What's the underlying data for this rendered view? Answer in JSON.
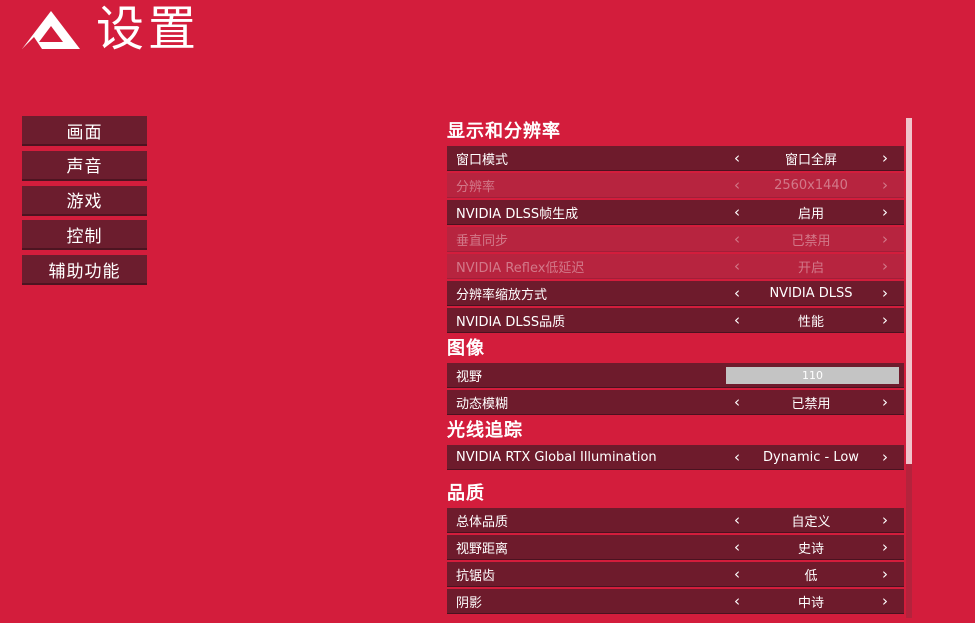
{
  "header": {
    "title": "设置"
  },
  "nav": {
    "items": [
      {
        "label": "画面"
      },
      {
        "label": "声音"
      },
      {
        "label": "游戏"
      },
      {
        "label": "控制"
      },
      {
        "label": "辅助功能"
      }
    ]
  },
  "sections": {
    "display": {
      "title": "显示和分辨率",
      "rows": [
        {
          "label": "窗口模式",
          "value": "窗口全屏"
        },
        {
          "label": "分辨率",
          "value": "2560x1440"
        },
        {
          "label": "NVIDIA DLSS帧生成",
          "value": "启用"
        },
        {
          "label": "垂直同步",
          "value": "已禁用"
        },
        {
          "label": "NVIDIA Reflex低延迟",
          "value": "开启"
        },
        {
          "label": "分辨率缩放方式",
          "value": "NVIDIA DLSS"
        },
        {
          "label": "NVIDIA DLSS品质",
          "value": "性能"
        }
      ]
    },
    "image": {
      "title": "图像",
      "rows": [
        {
          "label": "视野",
          "value": "110",
          "slider_fraction": 1.0
        },
        {
          "label": "动态模糊",
          "value": "已禁用"
        }
      ]
    },
    "raytracing": {
      "title": "光线追踪",
      "rows": [
        {
          "label": "NVIDIA RTX Global Illumination",
          "value": "Dynamic - Low"
        }
      ]
    },
    "quality": {
      "title": "品质",
      "rows": [
        {
          "label": "总体品质",
          "value": "自定义"
        },
        {
          "label": "视野距离",
          "value": "史诗"
        },
        {
          "label": "抗锯齿",
          "value": "低"
        },
        {
          "label": "阴影",
          "value": "中诗"
        }
      ]
    }
  },
  "arrows": {
    "left": "‹",
    "right": "›"
  },
  "colors": {
    "background": "#d31d3c",
    "row": "#6e1b2c",
    "row_disabled": "#b7243f",
    "slider_fill": "#c4c4c4"
  },
  "icons": {
    "logo": "triangle-a-logo-icon",
    "prev": "chevron-left-icon",
    "next": "chevron-right-icon"
  }
}
